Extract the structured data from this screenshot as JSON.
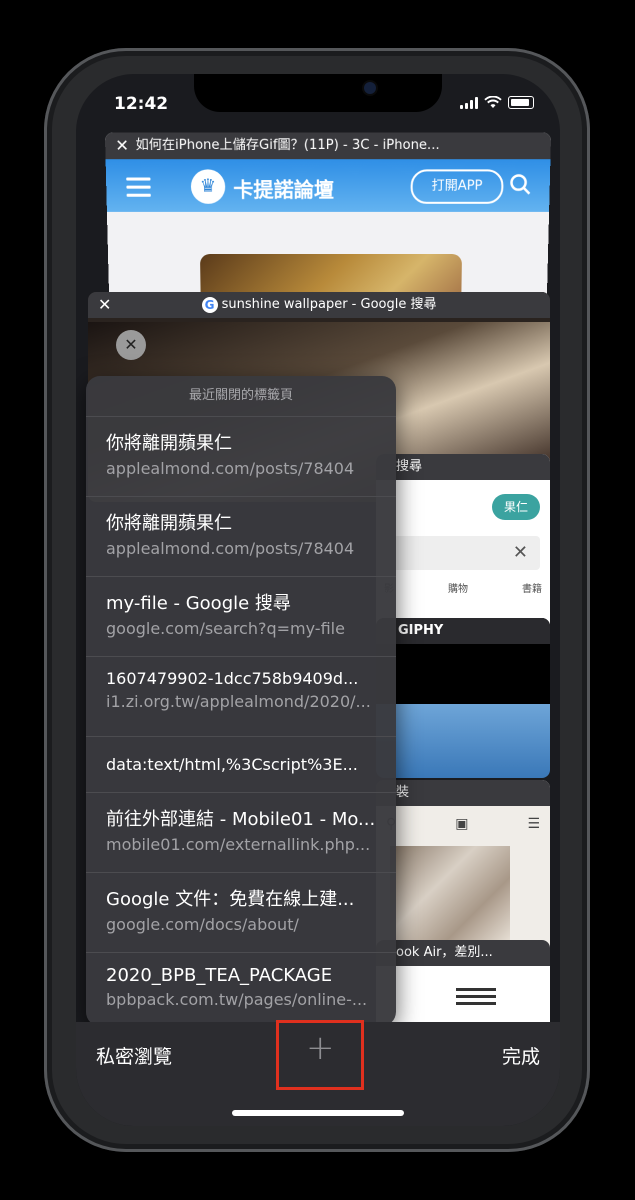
{
  "status": {
    "time": "12:42"
  },
  "cards": {
    "top": {
      "title": "如何在iPhone上儲存Gif圖？(11P) - 3C - iPhone...",
      "site_name": "卡提諾論壇",
      "open_app": "打開APP"
    },
    "google": {
      "title": "sunshine wallpaper - Google 搜尋"
    },
    "c3": {
      "title": "搜尋",
      "pill": "果仁",
      "tab1": "影",
      "tab2": "購物",
      "tab3": "書籍"
    },
    "c4": {
      "title": "GIPHY"
    },
    "c5": {
      "title": "裝"
    },
    "c6": {
      "title": "ook Air，差別..."
    }
  },
  "recently_closed": {
    "header": "最近關閉的標籤頁",
    "items": [
      {
        "title": "你將離開蘋果仁",
        "url": "applealmond.com/posts/78404"
      },
      {
        "title": "你將離開蘋果仁",
        "url": "applealmond.com/posts/78404"
      },
      {
        "title": "my-file - Google 搜尋",
        "url": "google.com/search?q=my-file"
      },
      {
        "title": "1607479902-1dcc758b9409d...",
        "url": "i1.zi.org.tw/applealmond/2020/..."
      },
      {
        "title": "data:text/html,%3Cscript%3E..."
      },
      {
        "title": "前往外部連結 - Mobile01 - Mo...",
        "url": "mobile01.com/externallink.php..."
      },
      {
        "title": "Google 文件：免費在線上建...",
        "url": "google.com/docs/about/"
      },
      {
        "title": "2020_BPB_TEA_PACKAGE",
        "url": "bpbpack.com.tw/pages/online-..."
      }
    ]
  },
  "bottom_bar": {
    "private": "私密瀏覽",
    "add": "+",
    "done": "完成"
  },
  "colors": {
    "highlight": "#e0301e",
    "accent": "#2f8fe6"
  }
}
